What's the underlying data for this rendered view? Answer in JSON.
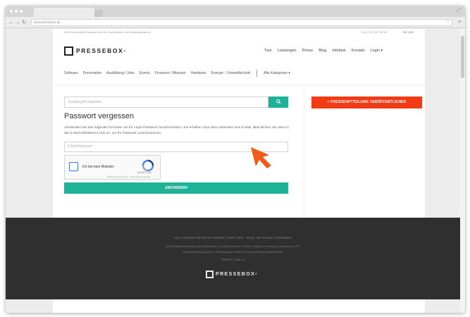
{
  "browser": {
    "url": "www.pressebox.de",
    "nav_back": "←",
    "nav_forward": "→",
    "nav_reload": "↻",
    "star_icon": "☆",
    "menu_icon": "≡",
    "expand_icon": "⤢"
  },
  "header": {
    "tagline": "Der Technologie Presseservice für Journalisten und Meinungsmacher",
    "phone": "+49 (721) 667793-00",
    "languages": "DE | EN",
    "logo_text": "PRESSEBOX",
    "logo_mark": "®"
  },
  "top_nav": [
    "Tour",
    "Leistungen",
    "Preise",
    "Blog",
    "Infothek",
    "Kontakt",
    "Login ▾"
  ],
  "categories": [
    "Software",
    "Personalien",
    "Ausbildung / Jobs",
    "Events",
    "Finanzen / Bilanzen",
    "Hardware",
    "Energie- / Umwelttechnik"
  ],
  "all_categories": "Alle Kategorien ▾",
  "search": {
    "placeholder": "Suchbegriff eingeben",
    "button_icon": "search-icon"
  },
  "publish_button": "+   PRESSEMITTEILUNG VERÖFFENTLICHEN",
  "form": {
    "title": "Passwort vergessen",
    "description": "Verwenden Sie das folgende Formular, um Ihr Login-Passwort zurückzusetzen. Sie erhalten nach dem Absenden eine E-Mail. Bitte klicken Sie dann in der E-Mail enthaltenen Link an, um Ihr Passwort zurückzusetzen.",
    "email_placeholder": "E-Mail Adresse*",
    "recaptcha_label": "Ich bin kein Roboter.",
    "recaptcha_brand": "reCAPTCHA",
    "recaptcha_terms": "Datenschutzerklärung - Nutzungsbedingungen",
    "submit": "ANFORDERN"
  },
  "footer": {
    "copyright": "unn | UNITED NEWS NETWORK GmbH 2002 - 2018, Alle Rechte vorbehalten",
    "links_1": "AGB | Datenschutzerklärung | Nutzerkonten | Kontakt | Service | Presse | Sitemap | Verlinkbox | Impressum | RSS",
    "links_2": "Pressemitteilung erstellen | Pressemappe erstellen | Pressemitteilung veröffentlichen",
    "partner": "Partner: | unn.cx",
    "logo_text": "PRESSEBOX",
    "logo_mark": "®"
  },
  "colors": {
    "teal": "#1eb298",
    "orange": "#f03b14",
    "footer_bg": "#2f2f2f"
  }
}
